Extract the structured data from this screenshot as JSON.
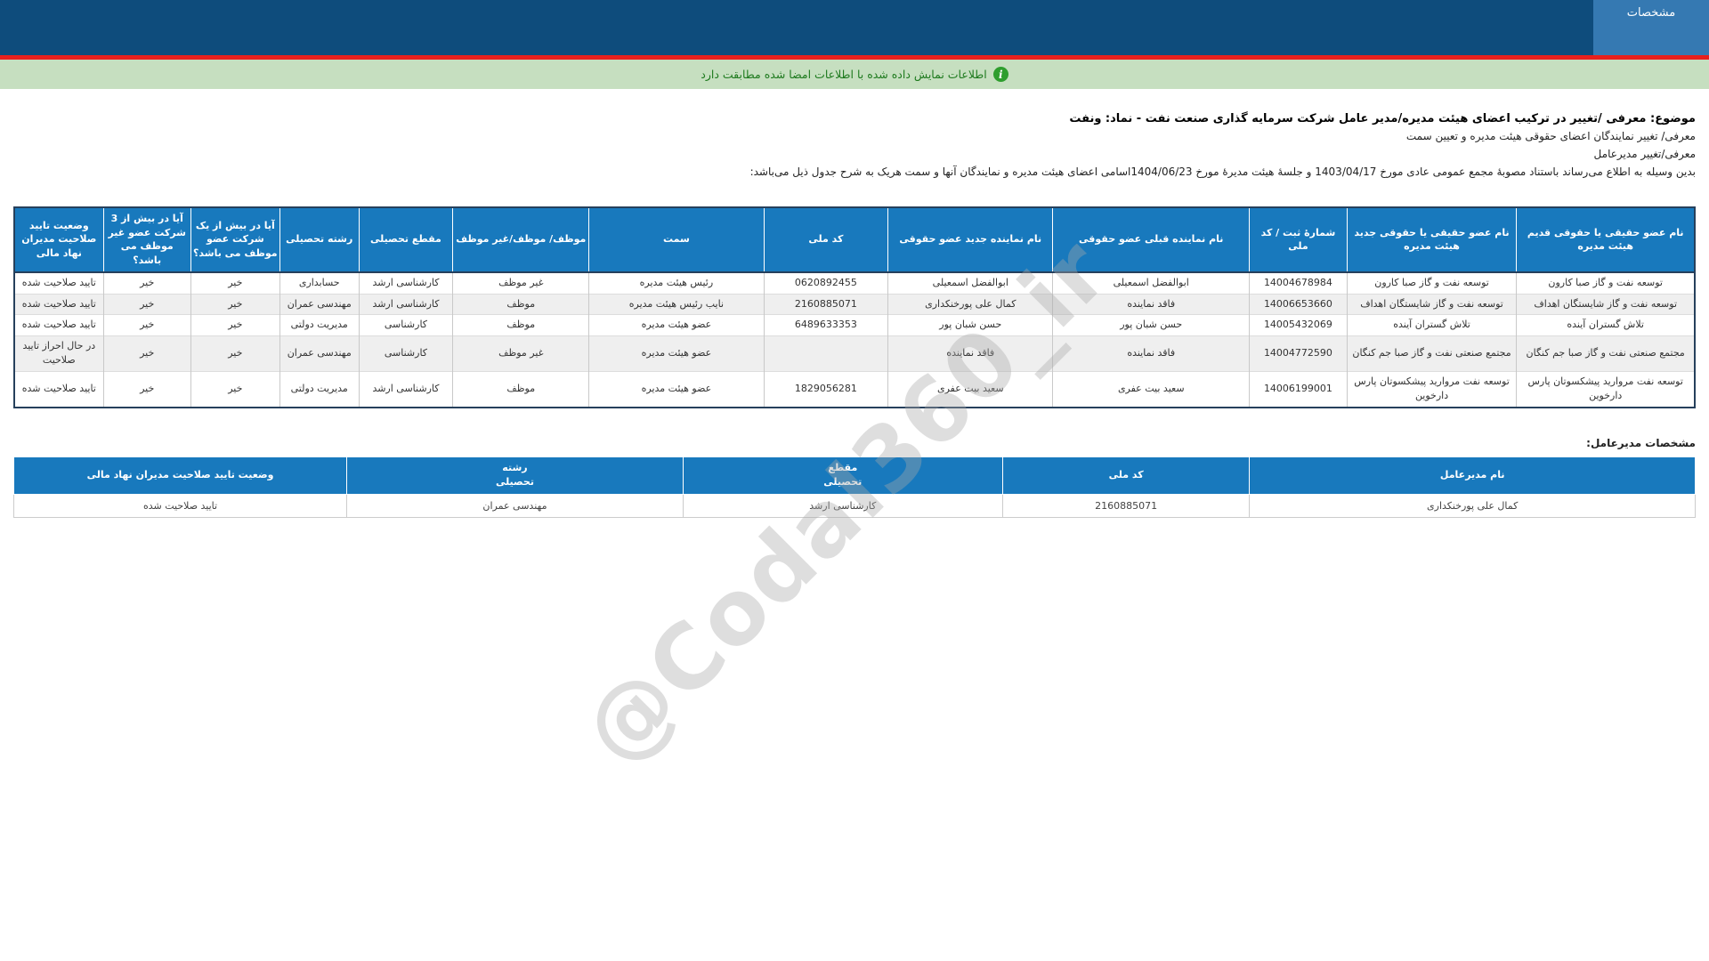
{
  "header": {
    "tab_label": "مشخصات"
  },
  "info_bar": {
    "text": "اطلاعات نمایش داده شده با اطلاعات امضا شده مطابقت دارد"
  },
  "intro": {
    "subject": "موضوع: معرفی /تغییر در ترکیب اعضای هیئت مدیره/مدیر عامل شرکت سرمایه گذاری صنعت نفت - نماد: ونفت",
    "line2": "معرفی/ تغییر نمایندگان اعضای حقوقی هیئت مدیره و تعیین سمت",
    "line3": "معرفی/تغییر مدیرعامل",
    "line4": "بدین وسیله به اطلاع می‌رساند باستناد مصوبهٔ مجمع عمومی عادی مورخ 1403/04/17 و جلسهٔ هیئت مدیرهٔ مورخ 1404/06/23اسامی اعضای هیئت مدیره و نمایندگان آنها و سمت هریک به شرح جدول ذیل می‌باشد:"
  },
  "board_table": {
    "headers": [
      "نام عضو حقیقی یا حقوقی قدیم هیئت مدیره",
      "نام عضو حقیقی یا حقوقی جدید هیئت مدیره",
      "شمارهٔ ثبت / کد ملی",
      "نام نماینده قبلی عضو حقوقی",
      "نام نماینده جدید عضو حقوقی",
      "کد ملی",
      "سمت",
      "موظف/ موظف/غیر موظف",
      "مقطع تحصیلی",
      "رشته تحصیلی",
      "آیا در بیش از یک شرکت عضو موظف می باشد؟",
      "آیا در بیش از 3 شرکت عضو غیر موظف می باشد؟",
      "وضعیت تایید صلاحیت مدیران نهاد مالی"
    ],
    "rows": [
      [
        "توسعه نفت و گاز صبا کارون",
        "توسعه نفت و گاز صبا کارون",
        "14004678984",
        "ابوالفضل اسمعیلی",
        "ابوالفضل اسمعیلی",
        "0620892455",
        "رئیس هیئت مدیره",
        "غیر موظف",
        "کارشناسی ارشد",
        "حسابداری",
        "خیر",
        "خیر",
        "تایید صلاحیت شده"
      ],
      [
        "توسعه نفت و گاز شایستگان اهداف",
        "توسعه نفت و گاز شایستگان اهداف",
        "14006653660",
        "فاقد نماینده",
        "کمال علی پورخنکداری",
        "2160885071",
        "نایب رئیس هیئت مدیره",
        "موظف",
        "کارشناسی ارشد",
        "مهندسی عمران",
        "خیر",
        "خیر",
        "تایید صلاحیت شده"
      ],
      [
        "تلاش گستران آینده",
        "تلاش گستران آینده",
        "14005432069",
        "حسن شبان پور",
        "حسن شبان پور",
        "6489633353",
        "عضو هیئت مدیره",
        "موظف",
        "کارشناسی",
        "مدیریت دولتی",
        "خیر",
        "خیر",
        "تایید صلاحیت شده"
      ],
      [
        "مجتمع صنعتی نفت و گاز صبا جم کنگان",
        "مجتمع صنعتی نفت و گاز صبا جم کنگان",
        "14004772590",
        "فاقد نماینده",
        "فاقد نماینده",
        "",
        "عضو هیئت مدیره",
        "غیر موظف",
        "کارشناسی",
        "مهندسی عمران",
        "خیر",
        "خیر",
        "در حال احراز تایید صلاحیت"
      ],
      [
        "توسعه نفت مروارید پیشکسوتان پارس دارخوین",
        "توسعه نفت مروارید پیشکسوتان پارس دارخوین",
        "14006199001",
        "سعید بیت عفری",
        "سعید بیت عفری",
        "1829056281",
        "عضو هیئت مدیره",
        "موظف",
        "کارشناسی ارشد",
        "مدیریت دولتی",
        "خیر",
        "خیر",
        "تایید صلاحیت شده"
      ]
    ]
  },
  "ceo_section": {
    "label": "مشخصات مدیرعامل:",
    "headers": [
      "نام مدیرعامل",
      "کد ملی",
      "مقطع\nتحصیلی",
      "رشته\nتحصیلی",
      "وضعیت تایید صلاحیت مدیران نهاد مالی"
    ],
    "rows": [
      [
        "کمال علی پورخنکداری",
        "2160885071",
        "کارشناسی ارشد",
        "مهندسی عمران",
        "تایید صلاحیت شده"
      ]
    ]
  },
  "watermark": {
    "text": "@Codal360_ir"
  },
  "colors": {
    "topbar": "#0e4c7c",
    "tab": "#3579b2",
    "red_line": "#e8201d",
    "info_bg": "#c6dfc0",
    "info_text": "#1e7a1e",
    "table_header": "#1879bd",
    "row_alt": "#efefef"
  }
}
